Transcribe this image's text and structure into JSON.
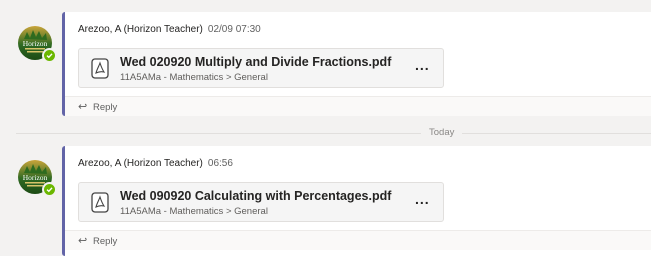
{
  "posts": [
    {
      "author": "Arezoo, A (Horizon Teacher)",
      "time": "02/09 07:30",
      "avatar_text": "Horizon",
      "file": {
        "name": "Wed 020920 Multiply and Divide Fractions.pdf",
        "path": "11A5AMa - Mathematics > General",
        "more": "..."
      },
      "reply_label": "Reply"
    },
    {
      "author": "Arezoo, A (Horizon Teacher)",
      "time": "06:56",
      "avatar_text": "Horizon",
      "file": {
        "name": "Wed 090920 Calculating with Percentages.pdf",
        "path": "11A5AMa - Mathematics > General",
        "more": "..."
      },
      "reply_label": "Reply"
    }
  ],
  "divider_label": "Today",
  "icons": {
    "file": "pdf-file-icon",
    "reply": "reply-arrow-icon",
    "presence": "available-presence-icon"
  },
  "colors": {
    "accent": "#6264a7",
    "presence": "#6bb700",
    "background": "#f3f2f1"
  }
}
